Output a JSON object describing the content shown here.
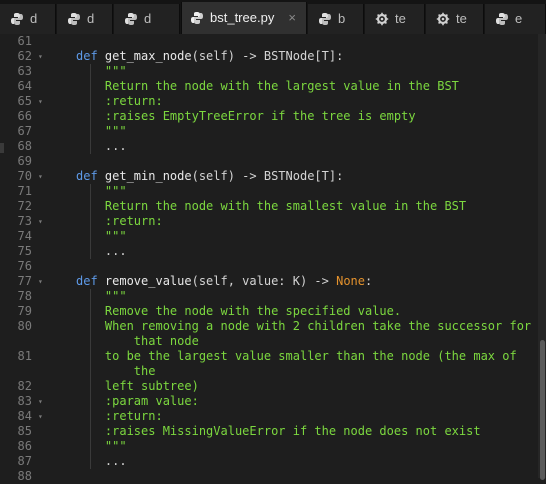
{
  "tabs": [
    {
      "label": "d"
    },
    {
      "label": "d"
    },
    {
      "label": "d"
    },
    {
      "label": "bst_tree.py",
      "active": true,
      "close": "×"
    },
    {
      "label": "b"
    },
    {
      "label": "te"
    },
    {
      "label": "te"
    },
    {
      "label": "e"
    }
  ],
  "icons": {
    "tab": "python-file-icon",
    "close": "close-icon",
    "fold": "fold-caret-icon"
  },
  "colors": {
    "background": "#1e1e1e",
    "keyword": "#5e9ae8",
    "docstring": "#7cd83f",
    "none_literal": "#e4922d",
    "line_number": "#7a7a7a"
  },
  "lines": [
    {
      "n": "61",
      "fold": false,
      "tokens": []
    },
    {
      "n": "62",
      "fold": true,
      "tokens": [
        {
          "t": "def ",
          "c": "kw"
        },
        {
          "t": "get_max_node",
          "c": "fn"
        },
        {
          "t": "(self) -> BSTNode[T]:",
          "c": "pl"
        }
      ]
    },
    {
      "n": "63",
      "fold": false,
      "tokens": [
        {
          "t": "    \"\"\"",
          "c": "doc"
        }
      ]
    },
    {
      "n": "64",
      "fold": false,
      "tokens": [
        {
          "t": "    Return the node with the largest value in the BST",
          "c": "doc"
        }
      ]
    },
    {
      "n": "65",
      "fold": true,
      "tokens": [
        {
          "t": "    :return:",
          "c": "doc"
        }
      ]
    },
    {
      "n": "66",
      "fold": false,
      "tokens": [
        {
          "t": "    :raises EmptyTreeError if the tree is empty",
          "c": "doc"
        }
      ]
    },
    {
      "n": "67",
      "fold": false,
      "tokens": [
        {
          "t": "    \"\"\"",
          "c": "doc"
        }
      ]
    },
    {
      "n": "68",
      "fold": false,
      "tokens": [
        {
          "t": "    ...",
          "c": "pl"
        }
      ]
    },
    {
      "n": "69",
      "fold": false,
      "tokens": []
    },
    {
      "n": "70",
      "fold": true,
      "tokens": [
        {
          "t": "def ",
          "c": "kw"
        },
        {
          "t": "get_min_node",
          "c": "fn"
        },
        {
          "t": "(self) -> BSTNode[T]:",
          "c": "pl"
        }
      ]
    },
    {
      "n": "71",
      "fold": false,
      "tokens": [
        {
          "t": "    \"\"\"",
          "c": "doc"
        }
      ]
    },
    {
      "n": "72",
      "fold": false,
      "tokens": [
        {
          "t": "    Return the node with the smallest value in the BST",
          "c": "doc"
        }
      ]
    },
    {
      "n": "73",
      "fold": true,
      "tokens": [
        {
          "t": "    :return:",
          "c": "doc"
        }
      ]
    },
    {
      "n": "74",
      "fold": false,
      "tokens": [
        {
          "t": "    \"\"\"",
          "c": "doc"
        }
      ]
    },
    {
      "n": "75",
      "fold": false,
      "tokens": [
        {
          "t": "    ...",
          "c": "pl"
        }
      ]
    },
    {
      "n": "76",
      "fold": false,
      "tokens": []
    },
    {
      "n": "77",
      "fold": true,
      "tokens": [
        {
          "t": "def ",
          "c": "kw"
        },
        {
          "t": "remove_value",
          "c": "fn"
        },
        {
          "t": "(self, value: K) -> ",
          "c": "pl"
        },
        {
          "t": "None",
          "c": "none"
        },
        {
          "t": ":",
          "c": "pl"
        }
      ]
    },
    {
      "n": "78",
      "fold": false,
      "tokens": [
        {
          "t": "    \"\"\"",
          "c": "doc"
        }
      ]
    },
    {
      "n": "79",
      "fold": false,
      "tokens": [
        {
          "t": "    Remove the node with the specified value.",
          "c": "doc"
        }
      ]
    },
    {
      "n": "80",
      "fold": false,
      "tokens": [
        {
          "t": "    When removing a node with 2 children take the successor for",
          "c": "doc"
        }
      ]
    },
    {
      "n": "",
      "fold": false,
      "tokens": [
        {
          "t": "        that node",
          "c": "doc"
        }
      ]
    },
    {
      "n": "81",
      "fold": false,
      "tokens": [
        {
          "t": "    to be the largest value smaller than the node (the max of",
          "c": "doc"
        }
      ]
    },
    {
      "n": "",
      "fold": false,
      "tokens": [
        {
          "t": "        the",
          "c": "doc"
        }
      ]
    },
    {
      "n": "82",
      "fold": false,
      "tokens": [
        {
          "t": "    left subtree)",
          "c": "doc"
        }
      ]
    },
    {
      "n": "83",
      "fold": true,
      "tokens": [
        {
          "t": "    :param value:",
          "c": "doc"
        }
      ]
    },
    {
      "n": "84",
      "fold": true,
      "tokens": [
        {
          "t": "    :return:",
          "c": "doc"
        }
      ]
    },
    {
      "n": "85",
      "fold": false,
      "tokens": [
        {
          "t": "    :raises MissingValueError if the node does not exist",
          "c": "doc"
        }
      ]
    },
    {
      "n": "86",
      "fold": false,
      "tokens": [
        {
          "t": "    \"\"\"",
          "c": "doc"
        }
      ]
    },
    {
      "n": "87",
      "fold": false,
      "tokens": [
        {
          "t": "    ...",
          "c": "pl"
        }
      ]
    },
    {
      "n": "88",
      "fold": false,
      "tokens": []
    }
  ]
}
